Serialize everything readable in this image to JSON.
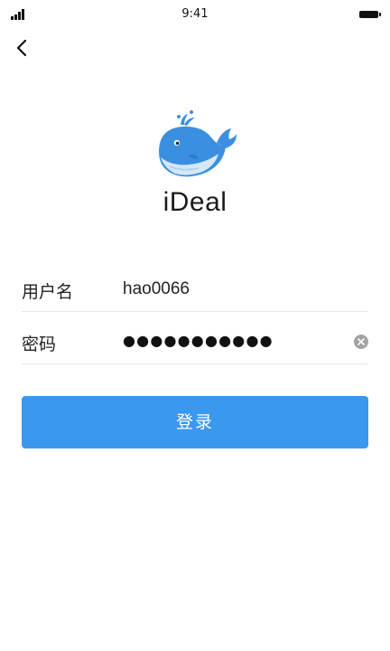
{
  "status_bar": {
    "time": "9:41",
    "icons": [
      "signal-icon",
      "battery-icon"
    ]
  },
  "nav": {
    "back_icon": "back-chevron-icon"
  },
  "app": {
    "name": "iDeal",
    "logo_icon": "whale-logo-icon"
  },
  "form": {
    "username_label": "用户名",
    "username_value": "hao0066",
    "password_label": "密码",
    "password_masked": "●●●●●●●●●●●",
    "clear_icon": "clear-icon"
  },
  "login_button_label": "登录",
  "colors": {
    "accent": "#3c97ef",
    "whale_body": "#3a8fe0",
    "whale_belly": "#d5e8f8",
    "divider": "#e8e8e8",
    "clear_icon_bg": "#a3a3a3"
  }
}
